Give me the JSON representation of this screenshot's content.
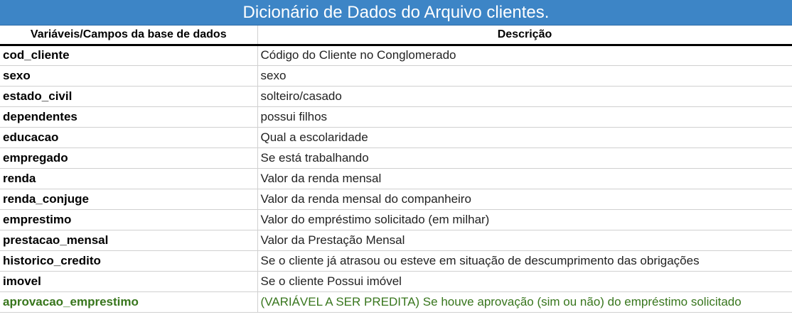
{
  "title": "Dicionário de Dados do Arquivo clientes.",
  "headers": {
    "variable": "Variáveis/Campos da base de dados",
    "description": "Descrição"
  },
  "rows": [
    {
      "variable": "cod_cliente",
      "description": "Código do Cliente no Conglomerado"
    },
    {
      "variable": "sexo",
      "description": "sexo"
    },
    {
      "variable": "estado_civil",
      "description": "solteiro/casado"
    },
    {
      "variable": "dependentes",
      "description": "possui filhos"
    },
    {
      "variable": "educacao",
      "description": "Qual a escolaridade"
    },
    {
      "variable": "empregado",
      "description": "Se está trabalhando"
    },
    {
      "variable": "renda",
      "description": "Valor da renda mensal"
    },
    {
      "variable": "renda_conjuge",
      "description": "Valor da renda mensal do companheiro"
    },
    {
      "variable": "emprestimo",
      "description": "Valor do empréstimo solicitado (em milhar)"
    },
    {
      "variable": "prestacao_mensal",
      "description": "Valor da Prestação Mensal"
    },
    {
      "variable": "historico_credito",
      "description": "Se o cliente já atrasou ou esteve em situação de descumprimento das obrigações"
    },
    {
      "variable": "imovel",
      "description": "Se o cliente Possui imóvel"
    },
    {
      "variable": "aprovacao_emprestimo",
      "description": "(VARIÁVEL A SER PREDITA) Se houve aprovação (sim ou  não) do empréstimo solicitado"
    }
  ],
  "colors": {
    "title_background": "#3d85c6",
    "target_text": "#38761d"
  }
}
